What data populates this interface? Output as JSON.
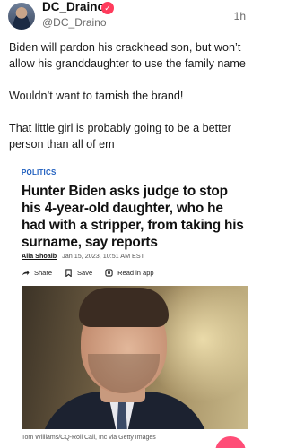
{
  "post": {
    "author_name": "DC_Draino",
    "verified_glyph": "✓",
    "handle": "@DC_Draino",
    "time": "1h",
    "paragraphs": [
      "Biden will pardon his crackhead son, but won’t allow his granddaughter to use the family name",
      "Wouldn’t want to tarnish the brand!",
      "That little girl is probably going to be a better person than all of em"
    ]
  },
  "article": {
    "section": "POLITICS",
    "headline": "Hunter Biden asks judge to stop his 4-year-old daughter, who he had with a stripper, from taking his surname, say reports",
    "byline_author": "Alia Shoaib",
    "byline_date": "Jan 15, 2023, 10:51 AM EST",
    "actions": {
      "share": "Share",
      "save": "Save",
      "read_in_app": "Read in app"
    },
    "photo_credit": "Tom Williams/CQ-Roll Call, Inc via Getty Images"
  },
  "colors": {
    "accent": "#ff3b5c",
    "section_link": "#1f5fbf"
  }
}
